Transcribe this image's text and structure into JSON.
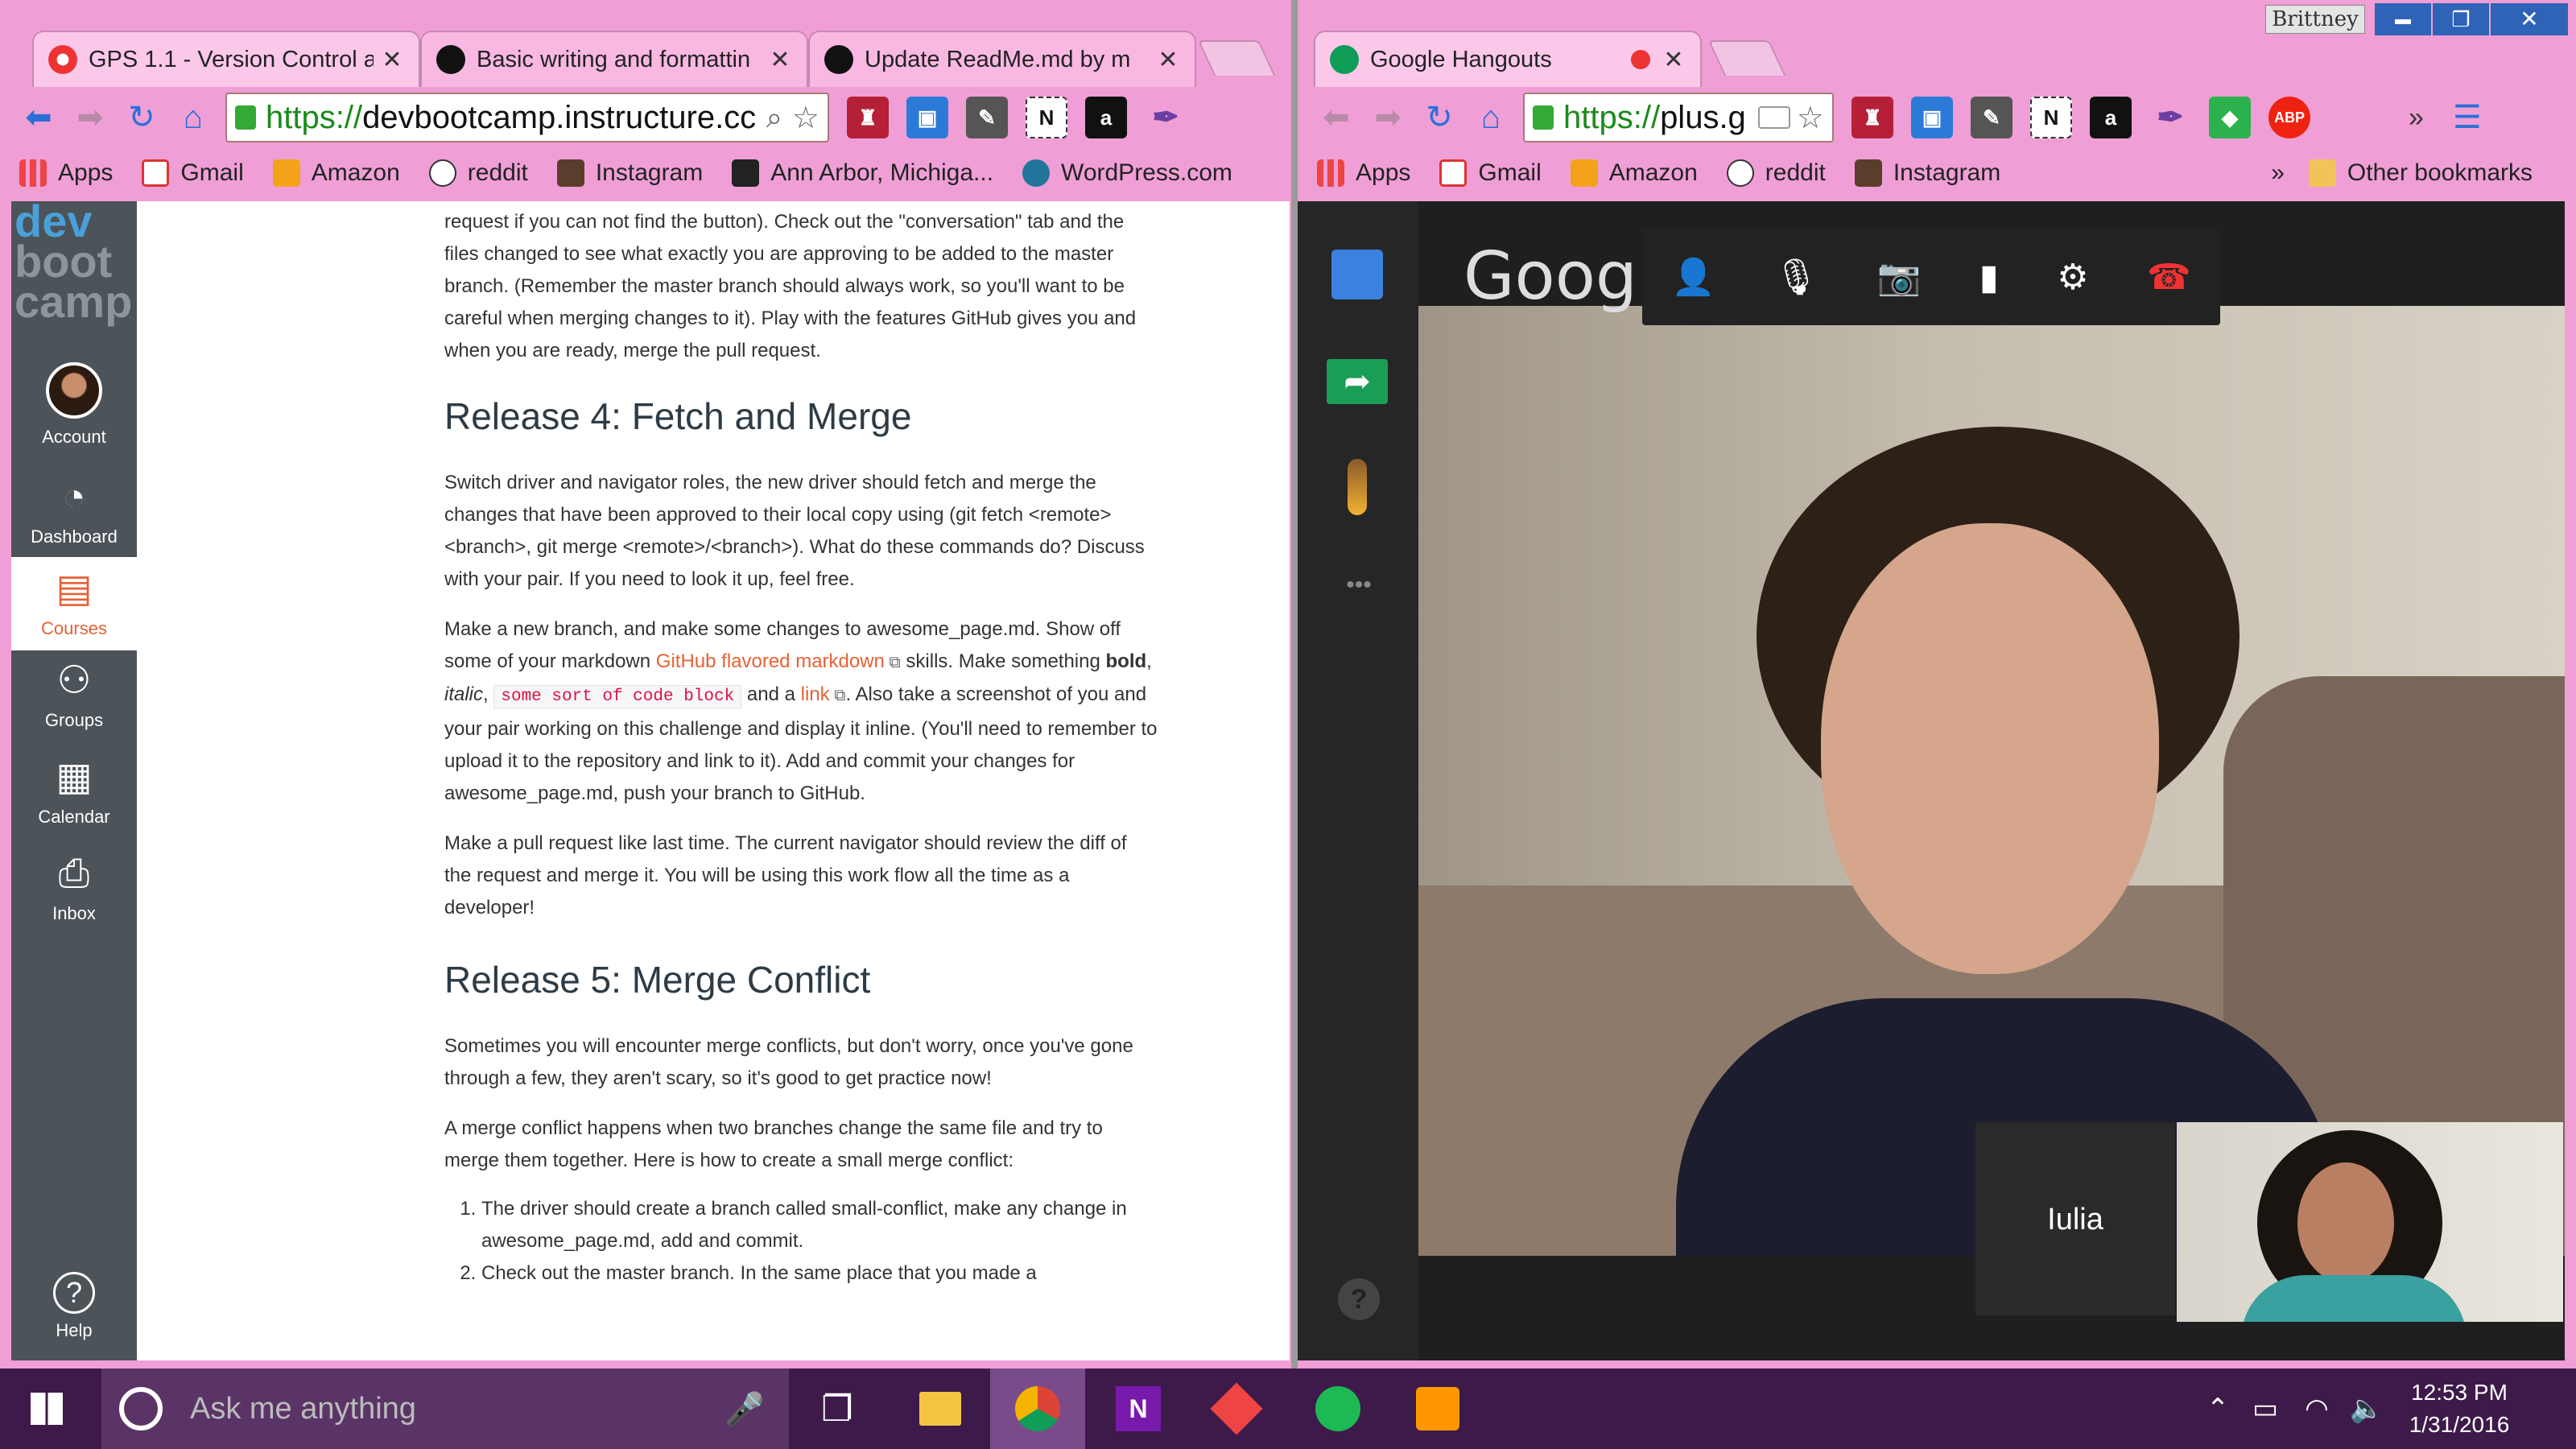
{
  "user_badge": "Brittney",
  "window_controls": {
    "minimize": "▬",
    "maximize": "❐",
    "close": "✕"
  },
  "left_window": {
    "tabs": [
      {
        "title": "GPS 1.1 - Version Control a"
      },
      {
        "title": "Basic writing and formattin"
      },
      {
        "title": "Update ReadMe.md by m"
      }
    ],
    "url_prefix": "https://",
    "url_host": "devbootcamp.instructure.cc",
    "bookmarks": [
      "Apps",
      "Gmail",
      "Amazon",
      "reddit",
      "Instagram",
      "Ann Arbor, Michiga...",
      "WordPress.com"
    ]
  },
  "right_window": {
    "tabs": [
      {
        "title": "Google Hangouts"
      }
    ],
    "url_prefix": "https://",
    "url_host": "plus.g",
    "bookmarks": [
      "Apps",
      "Gmail",
      "Amazon",
      "reddit",
      "Instagram"
    ],
    "bookmarks_more": "»",
    "other_bookmarks": "Other bookmarks",
    "ext_more": "»"
  },
  "canvas_nav": {
    "logo": [
      "dev",
      "boot",
      "camp"
    ],
    "items": [
      {
        "label": "Account",
        "icon": "avatar"
      },
      {
        "label": "Dashboard",
        "icon": "dashboard-icon"
      },
      {
        "label": "Courses",
        "icon": "courses-icon",
        "active": true
      },
      {
        "label": "Groups",
        "icon": "groups-icon"
      },
      {
        "label": "Calendar",
        "icon": "calendar-icon"
      },
      {
        "label": "Inbox",
        "icon": "inbox-icon"
      },
      {
        "label": "Help",
        "icon": "help-icon"
      }
    ]
  },
  "doc": {
    "p0": "request if you can not find the button). Check out the \"conversation\" tab and the files changed to see what exactly you are approving to be added to the master branch. (Remember the master branch should always work, so you'll want to be careful when merging changes to it). Play with the features GitHub gives you and when you are ready, merge the pull request.",
    "h_release4": "Release 4: Fetch and Merge",
    "p1": "Switch driver and navigator roles, the new driver should fetch and merge the changes that have been approved to their local copy using (git fetch <remote> <branch>, git merge <remote>/<branch>). What do these commands do? Discuss with your pair. If you need to look it up, feel free.",
    "p2_a": "Make a new branch, and make some changes to awesome_page.md. Show off some of your markdown ",
    "p2_link1": "GitHub flavored markdown",
    "p2_b": " skills. Make something ",
    "p2_bold": "bold",
    "p2_c": ", ",
    "p2_italic": "italic",
    "p2_d": ", ",
    "p2_code": "some sort of code block",
    "p2_e": " and a ",
    "p2_link2": "link",
    "p2_f": ". Also take a screenshot of you and your pair working on this challenge and display it inline. (You'll need to remember to upload it to the repository and link to it). Add and commit your changes for awesome_page.md, push your branch to GitHub.",
    "p3": "Make a pull request like last time. The current navigator should review the diff of the request and merge it. You will be using this work flow all the time as a developer!",
    "h_release5": "Release 5: Merge Conflict",
    "p4": "Sometimes you will encounter merge conflicts, but don't worry, once you've gone through a few, they aren't scary, so it's good to get practice now!",
    "p5": "A merge conflict happens when two branches change the same file and try to merge them together. Here is how to create a small merge conflict:",
    "li1": "The driver should create a branch called small-conflict, make any change in awesome_page.md, add and commit.",
    "li2": "Check out the master branch. In the same place that you made a"
  },
  "hangouts": {
    "logo": "Google",
    "participant_name": "Iulia",
    "help": "?",
    "more": "•••"
  },
  "taskbar": {
    "search_placeholder": "Ask me anything",
    "time": "12:53 PM",
    "date": "1/31/2016"
  }
}
